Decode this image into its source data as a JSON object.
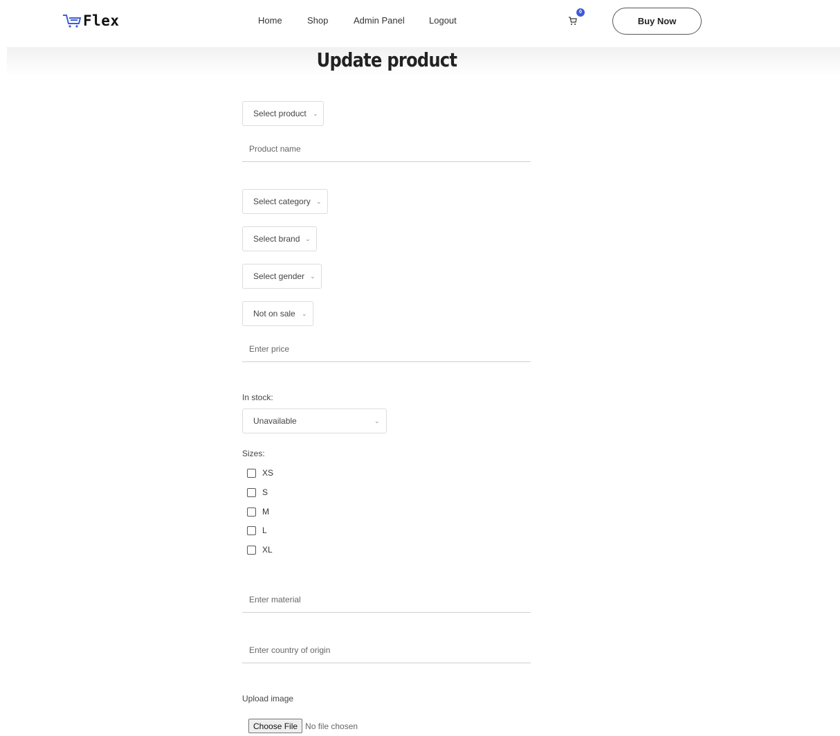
{
  "brand": {
    "name": "Flex",
    "accent_color": "#3f5bd8"
  },
  "nav": {
    "home": "Home",
    "shop": "Shop",
    "admin": "Admin Panel",
    "logout": "Logout",
    "cart_count": "0",
    "buy_now": "Buy Now"
  },
  "page": {
    "title": "Update product"
  },
  "form": {
    "select_product": "Select product",
    "product_name_placeholder": "Product name",
    "select_category": "Select category",
    "select_brand": "Select brand",
    "select_gender": "Select gender",
    "sale_status": "Not on sale",
    "price_placeholder": "Enter price",
    "in_stock_label": "In stock:",
    "in_stock_value": "Unavailable",
    "sizes_label": "Sizes:",
    "sizes": [
      "XS",
      "S",
      "M",
      "L",
      "XL"
    ],
    "material_placeholder": "Enter material",
    "origin_placeholder": "Enter country of origin",
    "upload_label": "Upload image",
    "file_button": "Choose File",
    "file_status": "No file chosen"
  }
}
